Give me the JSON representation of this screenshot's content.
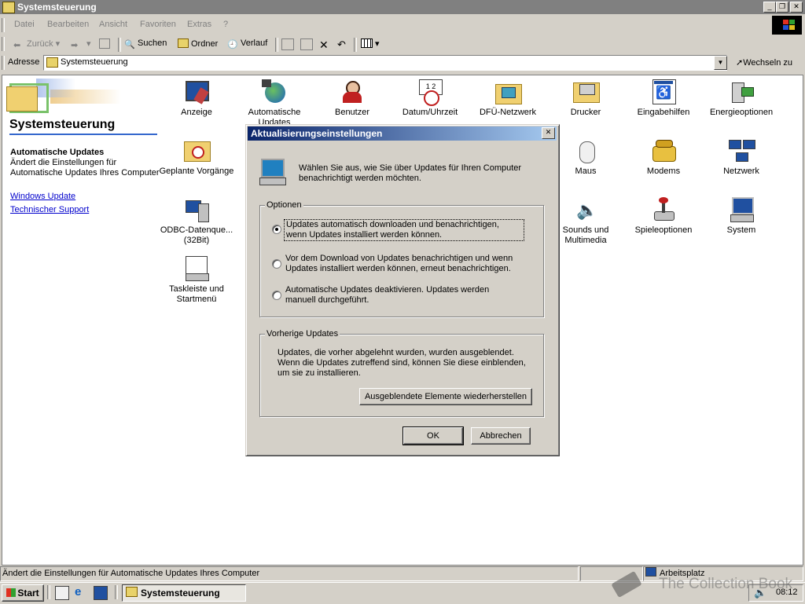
{
  "window": {
    "title": "Systemsteuerung"
  },
  "menu": [
    "Datei",
    "Bearbeiten",
    "Ansicht",
    "Favoriten",
    "Extras",
    "?"
  ],
  "toolbar": {
    "back": "Zurück",
    "forward": "",
    "search": "Suchen",
    "folders": "Ordner",
    "history": "Verlauf"
  },
  "address": {
    "label": "Adresse",
    "value": "Systemsteuerung",
    "go": "Wechseln zu"
  },
  "left_panel": {
    "title": "Systemsteuerung",
    "item_title": "Automatische Updates",
    "item_desc": "Ändert die Einstellungen für Automatische Updates Ihres Computer",
    "links": [
      "Windows Update",
      "Technischer Support"
    ]
  },
  "icons": [
    {
      "label": "Anzeige",
      "icon": "display-icon"
    },
    {
      "label": "Automatische Updates",
      "icon": "globe-update-icon"
    },
    {
      "label": "Benutzer",
      "icon": "users-icon"
    },
    {
      "label": "Datum/Uhrzeit",
      "icon": "calendar-clock-icon"
    },
    {
      "label": "DFÜ-Netzwerk",
      "icon": "dialup-network-icon"
    },
    {
      "label": "Drucker",
      "icon": "printer-folder-icon"
    },
    {
      "label": "Eingabehilfen",
      "icon": "accessibility-icon"
    },
    {
      "label": "Energieoptionen",
      "icon": "power-icon"
    },
    {
      "label": "Geplante Vorgänge",
      "icon": "scheduled-tasks-icon"
    },
    {
      "label": "Maus",
      "icon": "mouse-icon"
    },
    {
      "label": "Modems",
      "icon": "modem-phone-icon"
    },
    {
      "label": "Netzwerk",
      "icon": "network-icon"
    },
    {
      "label": "ODBC-Datenque... (32Bit)",
      "icon": "odbc-icon"
    },
    {
      "label": "Sounds und Multimedia",
      "icon": "speaker-icon"
    },
    {
      "label": "Spieleoptionen",
      "icon": "joystick-icon"
    },
    {
      "label": "System",
      "icon": "computer-icon"
    },
    {
      "label": "Taskleiste und Startmenü",
      "icon": "taskbar-icon"
    }
  ],
  "dialog": {
    "title": "Aktualisierungseinstellungen",
    "intro": "Wählen Sie aus, wie Sie über Updates für Ihren Computer benachrichtigt werden möchten.",
    "options_label": "Optionen",
    "options": [
      "Updates automatisch downloaden und benachrichtigen, wenn Updates installiert werden können.",
      "Vor dem Download von Updates benachrichtigen und wenn Updates installiert werden können, erneut benachrichtigen.",
      "Automatische Updates deaktivieren. Updates werden manuell durchgeführt."
    ],
    "selected_option": 0,
    "previous_label": "Vorherige Updates",
    "previous_text": "Updates, die vorher abgelehnt wurden, wurden ausgeblendet. Wenn die Updates zutreffend sind, können Sie diese einblenden, um sie zu installieren.",
    "restore_button": "Ausgeblendete Elemente wiederherstellen",
    "ok": "OK",
    "cancel": "Abbrechen"
  },
  "status": {
    "text": "Ändert die Einstellungen für Automatische Updates Ihres Computer",
    "zone": "Arbeitsplatz"
  },
  "taskbar": {
    "start": "Start",
    "task": "Systemsteuerung",
    "clock": "08:12"
  },
  "watermark": "The Collection Book"
}
